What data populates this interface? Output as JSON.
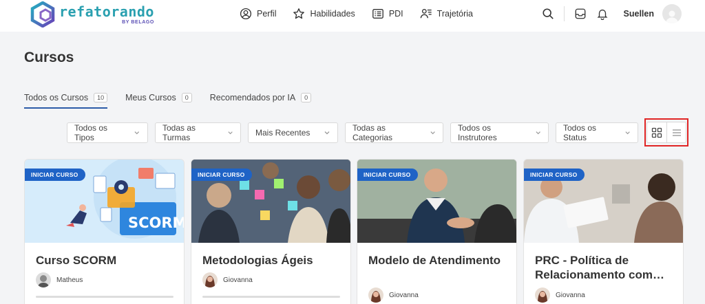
{
  "header": {
    "logo": {
      "word": "refatorando",
      "sub": "BY BELAGO"
    },
    "nav": [
      {
        "label": "Perfil",
        "icon": "user-circle-icon"
      },
      {
        "label": "Habilidades",
        "icon": "star-icon"
      },
      {
        "label": "PDI",
        "icon": "document-list-icon"
      },
      {
        "label": "Trajetória",
        "icon": "user-list-icon"
      }
    ],
    "user_name": "Suellen"
  },
  "page": {
    "title": "Cursos"
  },
  "tabs": [
    {
      "label": "Todos os Cursos",
      "count": "10",
      "active": true
    },
    {
      "label": "Meus Cursos",
      "count": "0",
      "active": false
    },
    {
      "label": "Recomendados por IA",
      "count": "0",
      "active": false
    }
  ],
  "filters": [
    {
      "label": "Todos os Tipos"
    },
    {
      "label": "Todas as Turmas"
    },
    {
      "label": "Mais Recentes"
    },
    {
      "label": "Todas as Categorias"
    },
    {
      "label": "Todos os Instrutores"
    },
    {
      "label": "Todos os Status"
    }
  ],
  "cards": [
    {
      "badge": "INICIAR CURSO",
      "title": "Curso SCORM",
      "author": "Matheus",
      "thumb_text": "SCORM"
    },
    {
      "badge": "INICIAR CURSO",
      "title": "Metodologias Ágeis",
      "author": "Giovanna"
    },
    {
      "badge": "INICIAR CURSO",
      "title": "Modelo de Atendimento",
      "author": "Giovanna"
    },
    {
      "badge": "INICIAR CURSO",
      "title": "PRC - Política de Relacionamento com…",
      "author": "Giovanna"
    }
  ],
  "colors": {
    "accent": "#1f63c6",
    "logo": "#2aa0b0",
    "highlight": "#e02424"
  }
}
